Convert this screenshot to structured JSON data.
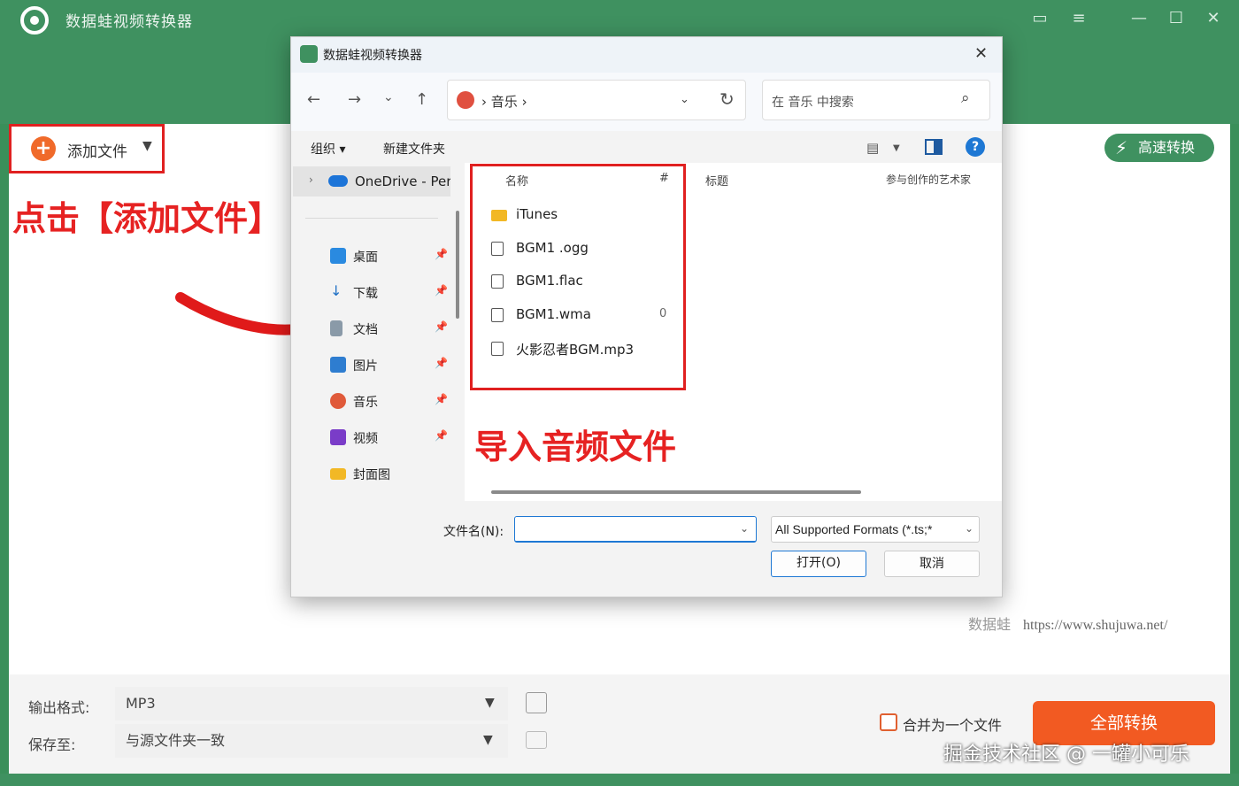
{
  "app": {
    "title": "数据蛙视频转换器",
    "accent_color": "#3f9160"
  },
  "window_controls": {
    "feedback_icon": "chat-icon",
    "menu_icon": "menu-icon",
    "minimize": "—",
    "maximize": "☐",
    "close": "✕"
  },
  "toolbar": {
    "add_file_label": "添加文件",
    "add_file_caret": "▼",
    "high_speed_label": "高速转换"
  },
  "annotations": {
    "left": "点击【添加文件】",
    "middle": "导入音频文件"
  },
  "watermark": {
    "brand": "数据蛙",
    "url": "https://www.shujuwa.net/"
  },
  "bottom": {
    "output_format_label": "输出格式:",
    "output_format_value": "MP3",
    "save_to_label": "保存至:",
    "save_to_value": "与源文件夹一致",
    "merge_label": "合并为一个文件",
    "convert_all_label": "全部转换",
    "credit": "掘金技术社区 @ 一罐小可乐"
  },
  "dialog": {
    "title": "数据蛙视频转换器",
    "close": "✕",
    "nav": {
      "back": "←",
      "forward": "→",
      "recent": "⌄",
      "up": "↑",
      "breadcrumb": "音乐",
      "breadcrumb_sep": "›",
      "refresh": "↻",
      "search_placeholder": "在 音乐 中搜索"
    },
    "commands": {
      "organize": "组织 ▾",
      "new_folder": "新建文件夹"
    },
    "sidebar": {
      "onedrive": "OneDrive - Per",
      "items": [
        {
          "label": "桌面",
          "icon": "desktop-icon",
          "color": "#2a8ae0"
        },
        {
          "label": "下载",
          "icon": "download-icon",
          "color": "#1e6fc4"
        },
        {
          "label": "文档",
          "icon": "document-icon",
          "color": "#8a9aa8"
        },
        {
          "label": "图片",
          "icon": "pictures-icon",
          "color": "#2e7dd0"
        },
        {
          "label": "音乐",
          "icon": "music-icon",
          "color": "#e05a3a"
        },
        {
          "label": "视频",
          "icon": "video-icon",
          "color": "#7a3cc8"
        },
        {
          "label": "封面图",
          "icon": "folder-icon",
          "color": "#f2b825"
        }
      ]
    },
    "columns": {
      "name": "名称",
      "number": "#",
      "title": "标题",
      "artist": "参与创作的艺术家"
    },
    "files": [
      {
        "name": "iTunes",
        "type": "folder",
        "num": ""
      },
      {
        "name": "BGM1 .ogg",
        "type": "audio",
        "num": ""
      },
      {
        "name": "BGM1.flac",
        "type": "audio",
        "num": ""
      },
      {
        "name": "BGM1.wma",
        "type": "audio",
        "num": "0"
      },
      {
        "name": "火影忍者BGM.mp3",
        "type": "audio",
        "num": ""
      }
    ],
    "filename_label": "文件名(N):",
    "filename_value": "",
    "format_value": "All Supported Formats (*.ts;*",
    "open_label": "打开(O)",
    "cancel_label": "取消"
  }
}
